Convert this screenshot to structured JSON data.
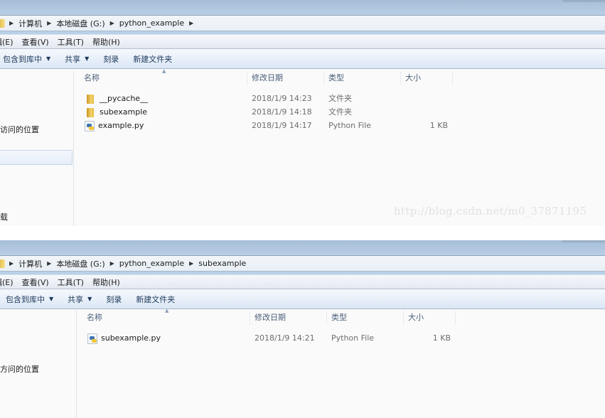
{
  "windows": [
    {
      "breadcrumb": [
        "计算机",
        "本地磁盘 (G:)",
        "python_example"
      ],
      "breadcrumb_trailing_arrow": true,
      "menu": [
        "辑(E)",
        "查看(V)",
        "工具(T)",
        "帮助(H)"
      ],
      "toolbar": {
        "include_in_library": "包含到库中",
        "share": "共享",
        "burn": "刻录",
        "new_folder": "新建文件夹",
        "caret": "▼"
      },
      "nav": {
        "recent_places": "访问的位置",
        "downloads": "载"
      },
      "columns": {
        "name": "名称",
        "date": "修改日期",
        "type": "类型",
        "size": "大小"
      },
      "files": [
        {
          "icon": "folder-icon",
          "name": "__pycache__",
          "date": "2018/1/9 14:23",
          "type": "文件夹",
          "size": ""
        },
        {
          "icon": "folder-icon",
          "name": "subexample",
          "date": "2018/1/9 14:18",
          "type": "文件夹",
          "size": ""
        },
        {
          "icon": "python-file-icon",
          "name": "example.py",
          "date": "2018/1/9 14:17",
          "type": "Python File",
          "size": "1 KB"
        }
      ],
      "watermark": "http://blog.csdn.net/m0_37871195"
    },
    {
      "breadcrumb": [
        "计算机",
        "本地磁盘 (G:)",
        "python_example",
        "subexample"
      ],
      "breadcrumb_trailing_arrow": false,
      "menu": [
        "辑(E)",
        "查看(V)",
        "工具(T)",
        "帮助(H)"
      ],
      "toolbar": {
        "include_in_library": "包含到库中",
        "share": "共享",
        "burn": "刻录",
        "new_folder": "新建文件夹",
        "caret": "▼"
      },
      "nav": {
        "recent_places": "方问的位置"
      },
      "columns": {
        "name": "名称",
        "date": "修改日期",
        "type": "类型",
        "size": "大小"
      },
      "files": [
        {
          "icon": "python-file-icon",
          "name": "subexample.py",
          "date": "2018/1/9 14:21",
          "type": "Python File",
          "size": "1 KB"
        }
      ]
    }
  ],
  "glyphs": {
    "crumb_sep": "▶",
    "sort_up": "▲"
  }
}
